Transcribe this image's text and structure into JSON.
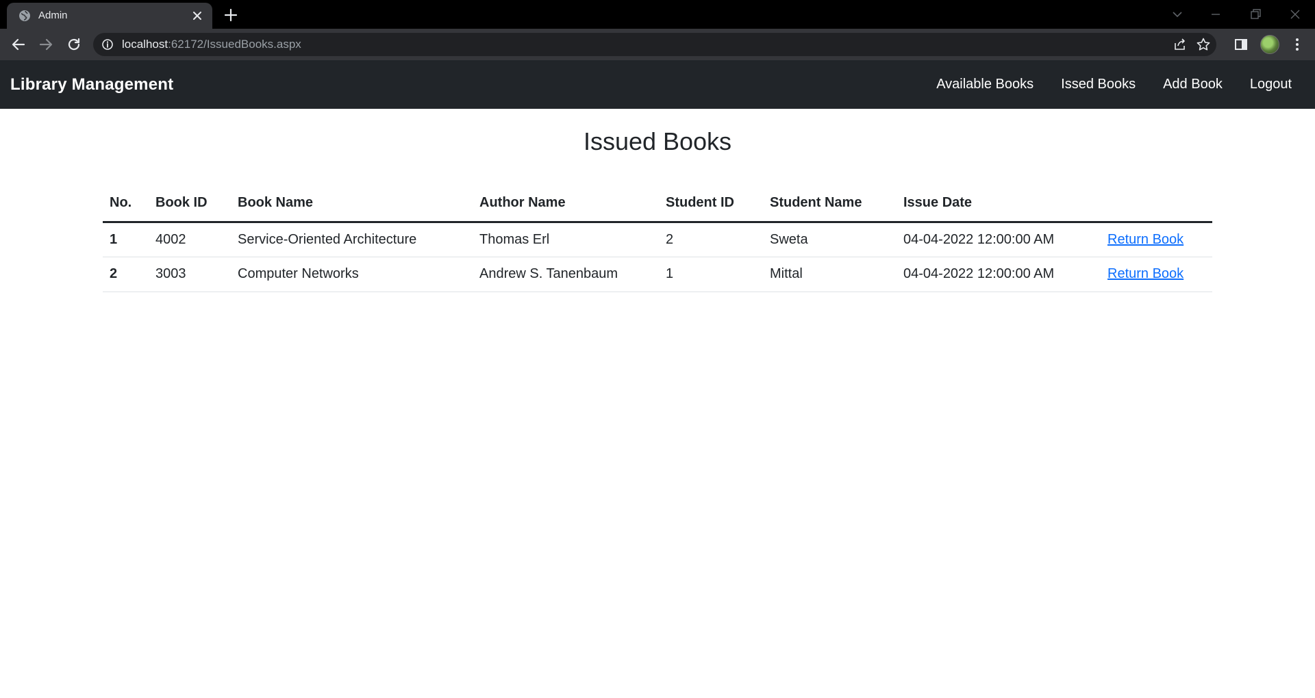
{
  "browser": {
    "tab_title": "Admin",
    "url_host": "localhost",
    "url_rest": ":62172/IssuedBooks.aspx"
  },
  "navbar": {
    "brand": "Library Management",
    "links": [
      {
        "label": "Available Books"
      },
      {
        "label": "Issed Books"
      },
      {
        "label": "Add Book"
      },
      {
        "label": "Logout"
      }
    ]
  },
  "page": {
    "title": "Issued Books"
  },
  "table": {
    "headers": [
      "No.",
      "Book ID",
      "Book Name",
      "Author Name",
      "Student ID",
      "Student Name",
      "Issue Date",
      ""
    ],
    "rows": [
      {
        "no": "1",
        "book_id": "4002",
        "book_name": "Service-Oriented Architecture",
        "author": "Thomas Erl",
        "student_id": "2",
        "student_name": "Sweta",
        "issue_date": "04-04-2022 12:00:00 AM",
        "action": "Return Book"
      },
      {
        "no": "2",
        "book_id": "3003",
        "book_name": "Computer Networks",
        "author": "Andrew S. Tanenbaum",
        "student_id": "1",
        "student_name": "Mittal",
        "issue_date": "04-04-2022 12:00:00 AM",
        "action": "Return Book"
      }
    ]
  },
  "icons": {
    "favicon": "globe-icon",
    "close": "close-icon",
    "new_tab": "plus-icon",
    "back": "back-arrow-icon",
    "forward": "forward-arrow-icon",
    "reload": "reload-icon",
    "info": "info-icon",
    "share": "share-icon",
    "bookmark": "star-icon",
    "side_panel": "side-panel-icon",
    "menu": "kebab-menu-icon"
  },
  "colors": {
    "navbar_bg": "#212529",
    "link": "#0d6efd",
    "text": "#212529"
  }
}
